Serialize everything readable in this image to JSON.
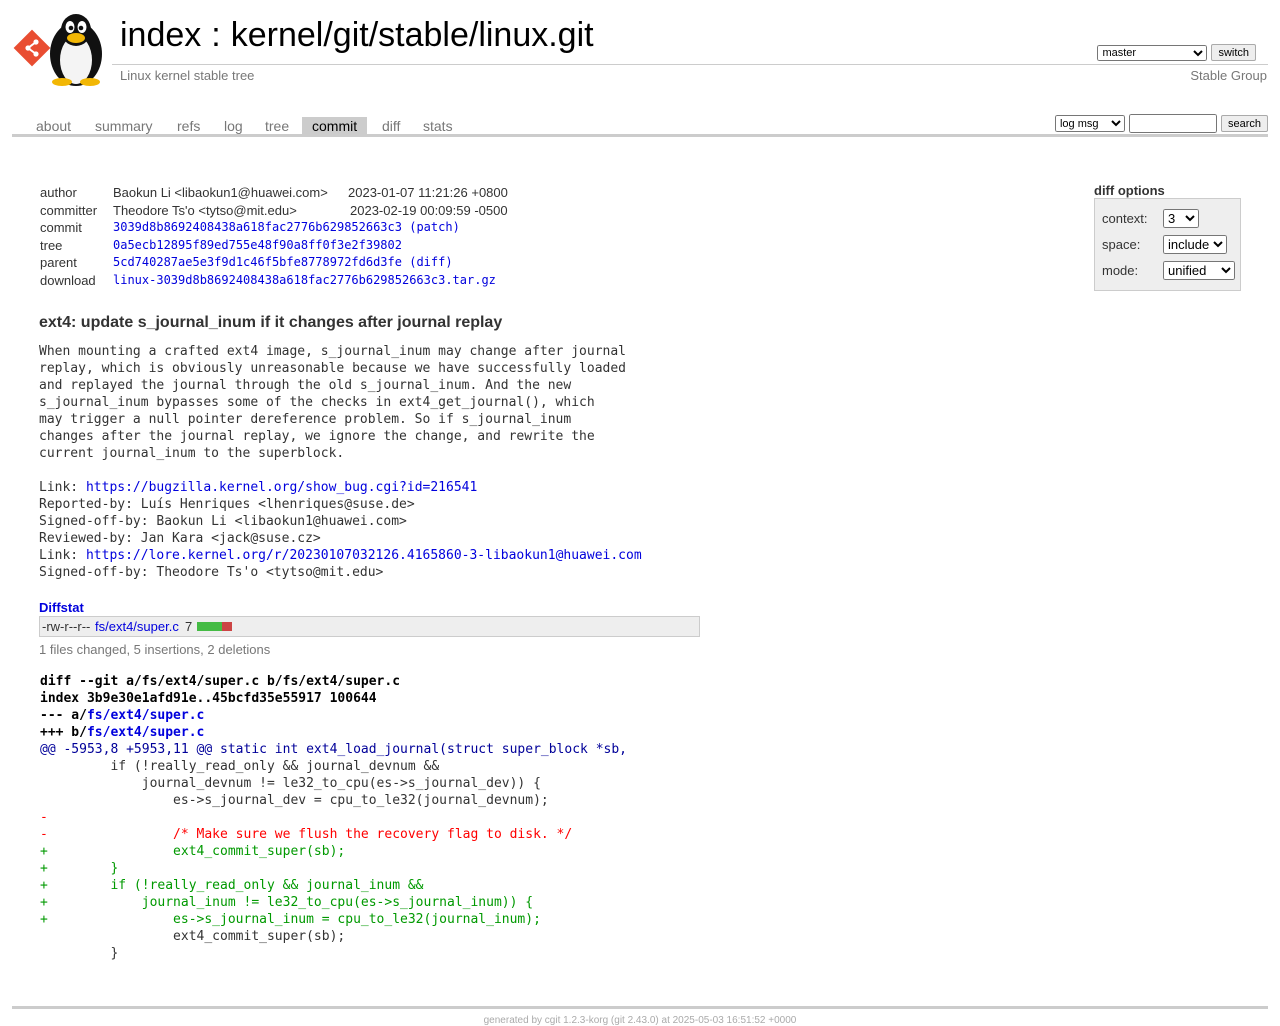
{
  "header": {
    "repo_title_index": "index",
    "repo_title_separator": ":",
    "repo_title_path": "kernel/git/stable/linux.git",
    "description": "Linux kernel stable tree",
    "owner": "Stable Group",
    "branch_selected": "master",
    "switch_label": "switch"
  },
  "tabs": [
    {
      "label": "about"
    },
    {
      "label": "summary"
    },
    {
      "label": "refs"
    },
    {
      "label": "log"
    },
    {
      "label": "tree"
    },
    {
      "label": "commit",
      "active": true
    },
    {
      "label": "diff"
    },
    {
      "label": "stats"
    }
  ],
  "search": {
    "select_value": "log msg",
    "input_value": "",
    "button_label": "search"
  },
  "commit_info": {
    "author_label": "author",
    "author": "Baokun Li <libaokun1@huawei.com>",
    "author_date": "2023-01-07 11:21:26 +0800",
    "committer_label": "committer",
    "committer": "Theodore Ts'o <tytso@mit.edu>",
    "committer_date": "2023-02-19 00:09:59 -0500",
    "commit_label": "commit",
    "commit_hash": "3039d8b8692408438a618fac2776b629852663c3",
    "commit_extra": "(patch)",
    "tree_label": "tree",
    "tree_hash": "0a5ecb12895f89ed755e48f90a8ff0f3e2f39802",
    "parent_label": "parent",
    "parent_hash": "5cd740287ae5e3f9d1c46f5bfe8778972fd6d3fe",
    "parent_extra": "(diff)",
    "download_label": "download",
    "download_link": "linux-3039d8b8692408438a618fac2776b629852663c3.tar.gz"
  },
  "diff_options": {
    "title": "diff options",
    "context_label": "context:",
    "context_value": "3",
    "space_label": "space:",
    "space_value": "include",
    "mode_label": "mode:",
    "mode_value": "unified"
  },
  "commit": {
    "subject": "ext4: update s_journal_inum if it changes after journal replay",
    "body_lines": [
      "When mounting a crafted ext4 image, s_journal_inum may change after journal",
      "replay, which is obviously unreasonable because we have successfully loaded",
      "and replayed the journal through the old s_journal_inum. And the new",
      "s_journal_inum bypasses some of the checks in ext4_get_journal(), which",
      "may trigger a null pointer dereference problem. So if s_journal_inum",
      "changes after the journal replay, we ignore the change, and rewrite the",
      "current journal_inum to the superblock.",
      ""
    ],
    "link1_prefix": "Link: ",
    "link1_url": "https://bugzilla.kernel.org/show_bug.cgi?id=216541",
    "reported_by": "Reported-by: Luís Henriques <lhenriques@suse.de>",
    "signed_off_1": "Signed-off-by: Baokun Li <libaokun1@huawei.com>",
    "reviewed_by": "Reviewed-by: Jan Kara <jack@suse.cz>",
    "link2_prefix": "Link: ",
    "link2_url": "https://lore.kernel.org/r/20230107032126.4165860-3-libaokun1@huawei.com",
    "signed_off_2": "Signed-off-by: Theodore Ts'o <tytso@mit.edu>"
  },
  "diffstat": {
    "title": "Diffstat",
    "mode": "-rw-r--r--",
    "file": "fs/ext4/super.c",
    "count": "7",
    "insertions": 5,
    "deletions": 2,
    "color_add": "#44bb44",
    "color_del": "#cc4444",
    "summary": "1 files changed, 5 insertions, 2 deletions"
  },
  "diff": {
    "line1": "diff --git a/fs/ext4/super.c b/fs/ext4/super.c",
    "line2": "index 3b9e30e1afd91e..45bcfd35e55917 100644",
    "minus_prefix": "--- a/",
    "plus_prefix": "+++ b/",
    "file": "fs/ext4/super.c",
    "hunk": "@@ -5953,8 +5953,11 @@ static int ext4_load_journal(struct super_block *sb,",
    "lines": [
      {
        "type": "ctx",
        "text": " \tif (!really_read_only && journal_devnum &&"
      },
      {
        "type": "ctx",
        "text": " \t    journal_devnum != le32_to_cpu(es->s_journal_dev)) {"
      },
      {
        "type": "ctx",
        "text": " \t\tes->s_journal_dev = cpu_to_le32(journal_devnum);"
      },
      {
        "type": "del",
        "text": "-"
      },
      {
        "type": "del",
        "text": "-\t\t/* Make sure we flush the recovery flag to disk. */"
      },
      {
        "type": "add",
        "text": "+\t\text4_commit_super(sb);"
      },
      {
        "type": "add",
        "text": "+\t}"
      },
      {
        "type": "add",
        "text": "+\tif (!really_read_only && journal_inum &&"
      },
      {
        "type": "add",
        "text": "+\t    journal_inum != le32_to_cpu(es->s_journal_inum)) {"
      },
      {
        "type": "add",
        "text": "+\t\tes->s_journal_inum = cpu_to_le32(journal_inum);"
      },
      {
        "type": "ctx",
        "text": " \t\text4_commit_super(sb);"
      },
      {
        "type": "ctx",
        "text": " \t}"
      }
    ]
  },
  "footer": {
    "text": "generated by cgit 1.2.3-korg (git 2.43.0) at 2025-05-03 16:51:52 +0000"
  },
  "icons": {
    "git_logo": "git-logo-icon",
    "tux_logo": "tux-penguin-icon"
  },
  "colors": {
    "link": "#0000dd",
    "diff_add": "#009900",
    "diff_del": "#ff0000",
    "hunk": "#000099",
    "tab_active_bg": "#cccccc"
  }
}
